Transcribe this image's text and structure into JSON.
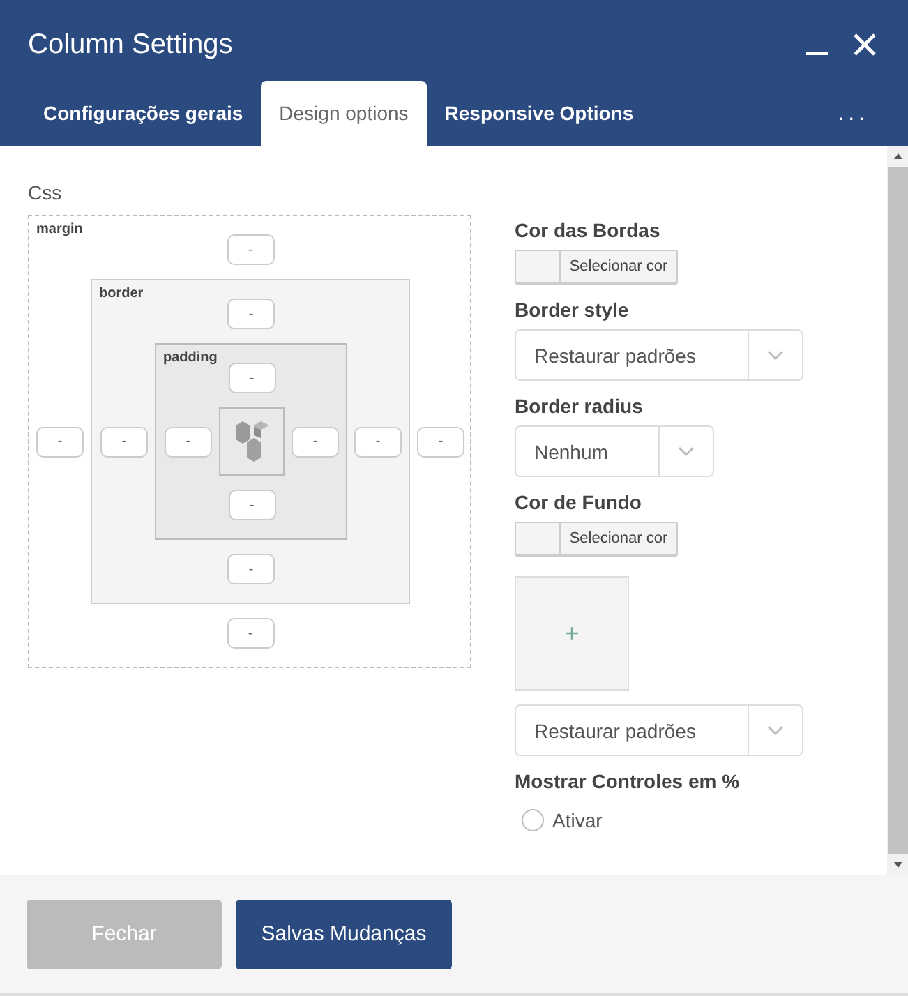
{
  "window": {
    "title": "Column Settings"
  },
  "tabs": [
    {
      "label": "Configurações gerais",
      "selected": false
    },
    {
      "label": "Design options",
      "selected": true
    },
    {
      "label": "Responsive Options",
      "selected": false
    }
  ],
  "overflow_menu": "...",
  "css_panel": {
    "heading": "Css",
    "box": {
      "label": "margin",
      "top": {
        "placeholder": "-"
      },
      "left": {
        "placeholder": "-"
      },
      "right": {
        "placeholder": "-"
      },
      "bottom": {
        "placeholder": "-"
      },
      "inner": {
        "label": "border",
        "top": {
          "placeholder": "-"
        },
        "left": {
          "placeholder": "-"
        },
        "right": {
          "placeholder": "-"
        },
        "bottom": {
          "placeholder": "-"
        },
        "inner": {
          "label": "padding",
          "top": {
            "placeholder": "-"
          },
          "left": {
            "placeholder": "-"
          },
          "right": {
            "placeholder": "-"
          },
          "bottom": {
            "placeholder": "-"
          }
        }
      }
    }
  },
  "options": [
    {
      "kind": "color",
      "label": "Cor das Bordas",
      "button": "Selecionar cor"
    },
    {
      "kind": "select",
      "label": "Border style",
      "value": "Restaurar padrões"
    },
    {
      "kind": "shortselect",
      "label": "Border radius",
      "value": "Nenhum"
    },
    {
      "kind": "color",
      "label": "Cor de Fundo",
      "button": "Selecionar cor"
    },
    {
      "kind": "image",
      "add": "+"
    },
    {
      "kind": "select",
      "value": "Restaurar padrões"
    },
    {
      "kind": "checkbox",
      "label": "Mostrar Controles em %",
      "option": "Ativar",
      "checked": false
    }
  ],
  "footer_buttons": [
    {
      "label": "Fechar",
      "kind": "secondary"
    },
    {
      "label": "Salvas Mudanças",
      "kind": "primary"
    }
  ]
}
